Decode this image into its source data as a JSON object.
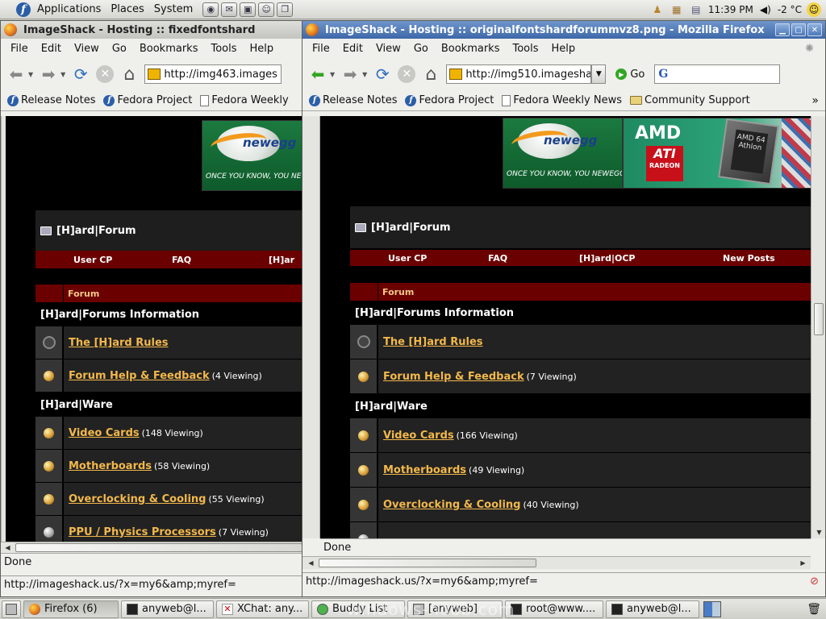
{
  "top_panel": {
    "menus": [
      "Applications",
      "Places",
      "System"
    ],
    "clock": "11:39 PM",
    "temperature": "-2 °C"
  },
  "window_left": {
    "title": "ImageShack - Hosting :: fixedfontshard",
    "url": "http://img463.images",
    "status": "Done",
    "link_status": "http://imageshack.us/?x=my6&amp;myref="
  },
  "window_right": {
    "title": "ImageShack - Hosting :: originalfontshardforummvz8.png - Mozilla Firefox",
    "url": "http://img510.imageshac",
    "go_label": "Go",
    "status": "Done",
    "link_status": "http://imageshack.us/?x=my6&amp;myref="
  },
  "menus": [
    "File",
    "Edit",
    "View",
    "Go",
    "Bookmarks",
    "Tools",
    "Help"
  ],
  "bookmarks": [
    "Release Notes",
    "Fedora Project",
    "Fedora Weekly News",
    "Community Support"
  ],
  "bookmarks_left_truncated": "Fedora Weekly",
  "banner": {
    "newegg_word": "newegg",
    "newegg_tagline": "ONCE YOU KNOW, YOU NEWEGG.",
    "newegg_tagline_left": "ONCE YOU KNOW, YOU NEWEG",
    "amd": "AMD",
    "ati": "ATI",
    "ati_sub": "RADEON",
    "chip_text": "AMD 64 Athlon"
  },
  "forum": {
    "title": "[H]ard|Forum",
    "nav": [
      "User CP",
      "FAQ",
      "[H]ard|OCP",
      "New Posts"
    ],
    "nav_left_truncated": "[H]ar",
    "column_header": "Forum",
    "sections": [
      {
        "name": "[H]ard|Forums Information",
        "rows": [
          {
            "name": "The [H]ard Rules",
            "viewing_left": "",
            "viewing_right": "",
            "icon": "lock-icon"
          },
          {
            "name": "Forum Help & Feedback",
            "viewing_left": "(4 Viewing)",
            "viewing_right": "(7 Viewing)",
            "icon": "bulb-icon"
          }
        ]
      },
      {
        "name": "[H]ard|Ware",
        "rows": [
          {
            "name": "Video Cards",
            "viewing_left": "(148 Viewing)",
            "viewing_right": "(166 Viewing)",
            "icon": "bulb-icon"
          },
          {
            "name": "Motherboards",
            "viewing_left": "(58 Viewing)",
            "viewing_right": "(49 Viewing)",
            "icon": "bulb-icon"
          },
          {
            "name": "Overclocking & Cooling",
            "viewing_left": "(55 Viewing)",
            "viewing_right": "(40 Viewing)",
            "icon": "bulb-icon"
          },
          {
            "name": "PPU / Physics Processors",
            "viewing_left": "(7 Viewing)",
            "viewing_right": "",
            "icon": "bulb-icon"
          }
        ]
      }
    ]
  },
  "taskbar": {
    "tasks": [
      "Firefox (6)",
      "anyweb@l...",
      "XChat: any...",
      "Buddy List",
      "[anyweb]",
      "root@www....",
      "anyweb@l..."
    ]
  },
  "watermark": "windows-noob.com",
  "colors": {
    "forum_red": "#6b0000",
    "forum_link": "#f2b84b",
    "active_title": "#3d68a9"
  }
}
